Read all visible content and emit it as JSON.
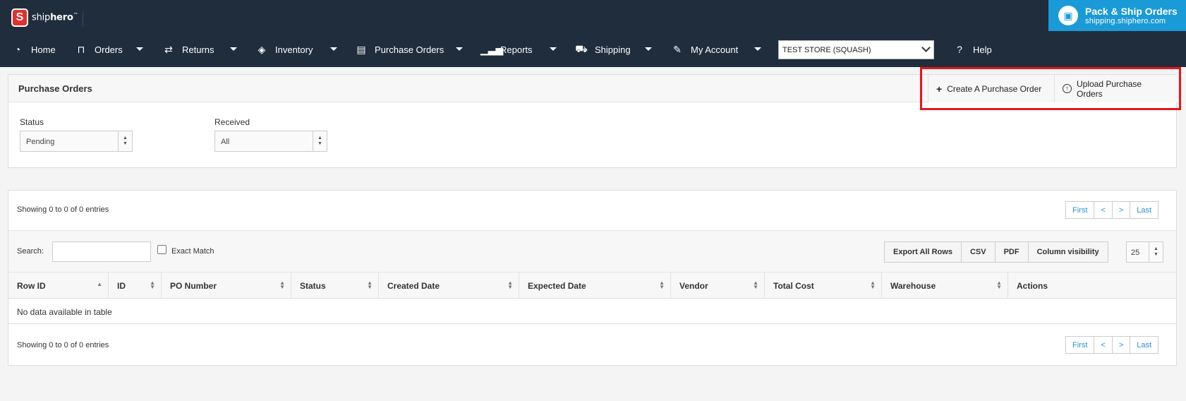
{
  "header": {
    "brand_name_light": "ship",
    "brand_name_bold": "hero",
    "brand_logo_letter": "S",
    "brand_tm": "™",
    "promo": {
      "title": "Pack & Ship Orders",
      "subtitle": "shipping.shiphero.com"
    }
  },
  "nav": {
    "items": [
      {
        "label": "Home",
        "icon": "dashboard-icon"
      },
      {
        "label": "Orders",
        "icon": "inbox-icon"
      },
      {
        "label": "Returns",
        "icon": "exchange-icon"
      },
      {
        "label": "Inventory",
        "icon": "tags-icon"
      },
      {
        "label": "Purchase Orders",
        "icon": "archive-icon"
      },
      {
        "label": "Reports",
        "icon": "signal-icon"
      },
      {
        "label": "Shipping",
        "icon": "truck-icon"
      },
      {
        "label": "My Account",
        "icon": "wrench-icon"
      },
      {
        "label": "Help",
        "icon": "question-circle-icon"
      }
    ],
    "store_select": "TEST STORE (SQUASH)"
  },
  "filters": {
    "title": "Purchase Orders",
    "create_button": "Create A Purchase Order",
    "upload_button": "Upload Purchase Orders",
    "status_label": "Status",
    "status_value": "Pending",
    "received_label": "Received",
    "received_value": "All"
  },
  "table": {
    "info_top": "Showing 0 to 0 of 0 entries",
    "info_bottom": "Showing 0 to 0 of 0 entries",
    "pager": [
      "First",
      "<",
      ">",
      "Last"
    ],
    "search_label": "Search:",
    "exact_match": "Exact Match",
    "tools": [
      "Export All Rows",
      "CSV",
      "PDF",
      "Column visibility"
    ],
    "page_length": "25",
    "columns": [
      "Row ID",
      "ID",
      "PO Number",
      "Status",
      "Created Date",
      "Expected Date",
      "Vendor",
      "Total Cost",
      "Warehouse",
      "Actions"
    ],
    "empty_message": "No data available in table"
  },
  "colors": {
    "header_bg": "#1f2d3d",
    "promo_bg": "#1a9ad6",
    "link": "#2a8fd0",
    "highlight": "#e8141b",
    "logo_red": "#e0312f"
  }
}
